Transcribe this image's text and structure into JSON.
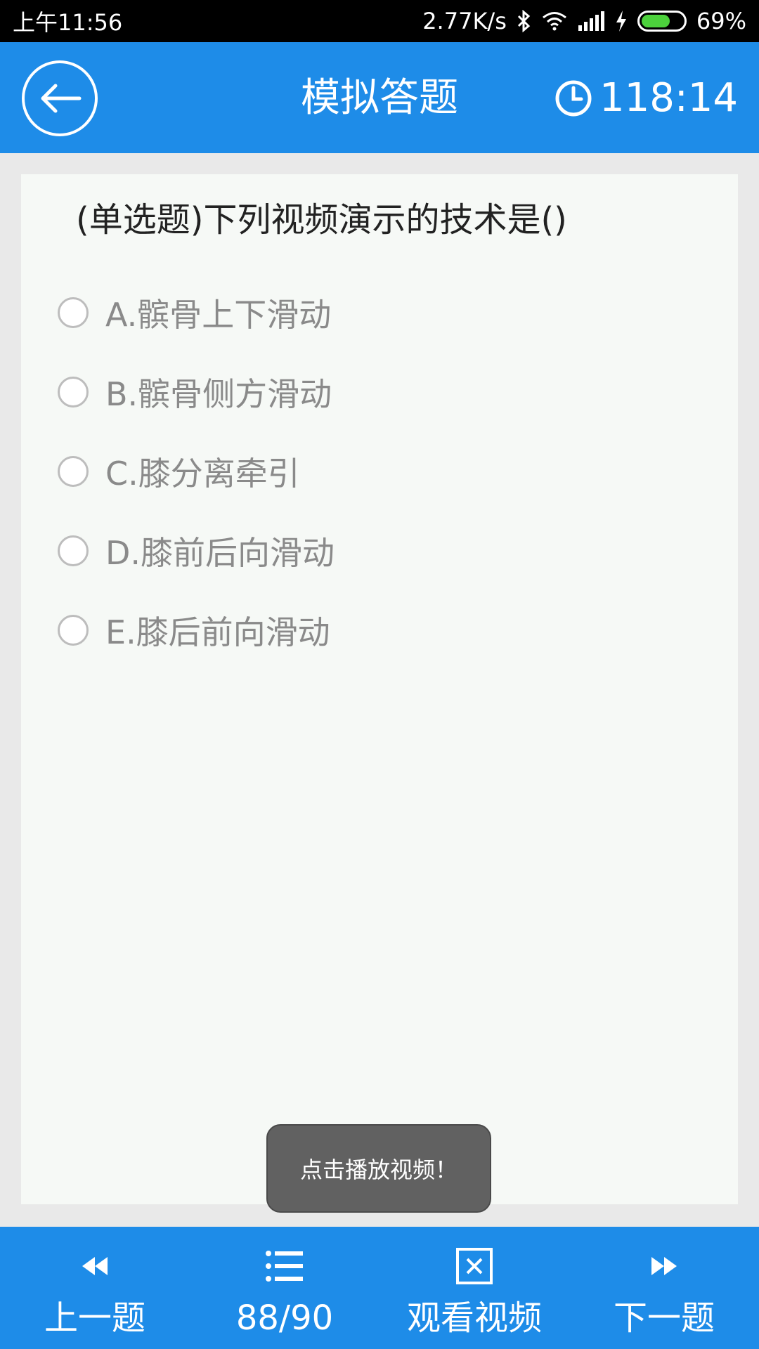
{
  "status_bar": {
    "time": "上午11:56",
    "net_speed": "2.77K/s",
    "battery": "69%",
    "battery_level": 0.69
  },
  "header": {
    "title": "模拟答题",
    "timer": "118:14"
  },
  "question": {
    "text": "(单选题)下列视频演示的技术是()",
    "options": [
      {
        "label": "A.髌骨上下滑动"
      },
      {
        "label": "B.髌骨侧方滑动"
      },
      {
        "label": "C.膝分离牵引"
      },
      {
        "label": "D.膝前后向滑动"
      },
      {
        "label": "E.膝后前向滑动"
      }
    ]
  },
  "toast": "点击播放视频！",
  "bottom_nav": {
    "prev": "上一题",
    "progress": "88/90",
    "video": "观看视频",
    "next": "下一题"
  },
  "colors": {
    "primary": "#1e8ce8",
    "card_bg": "#f6f9f6",
    "option_text": "#8a8a8a"
  }
}
